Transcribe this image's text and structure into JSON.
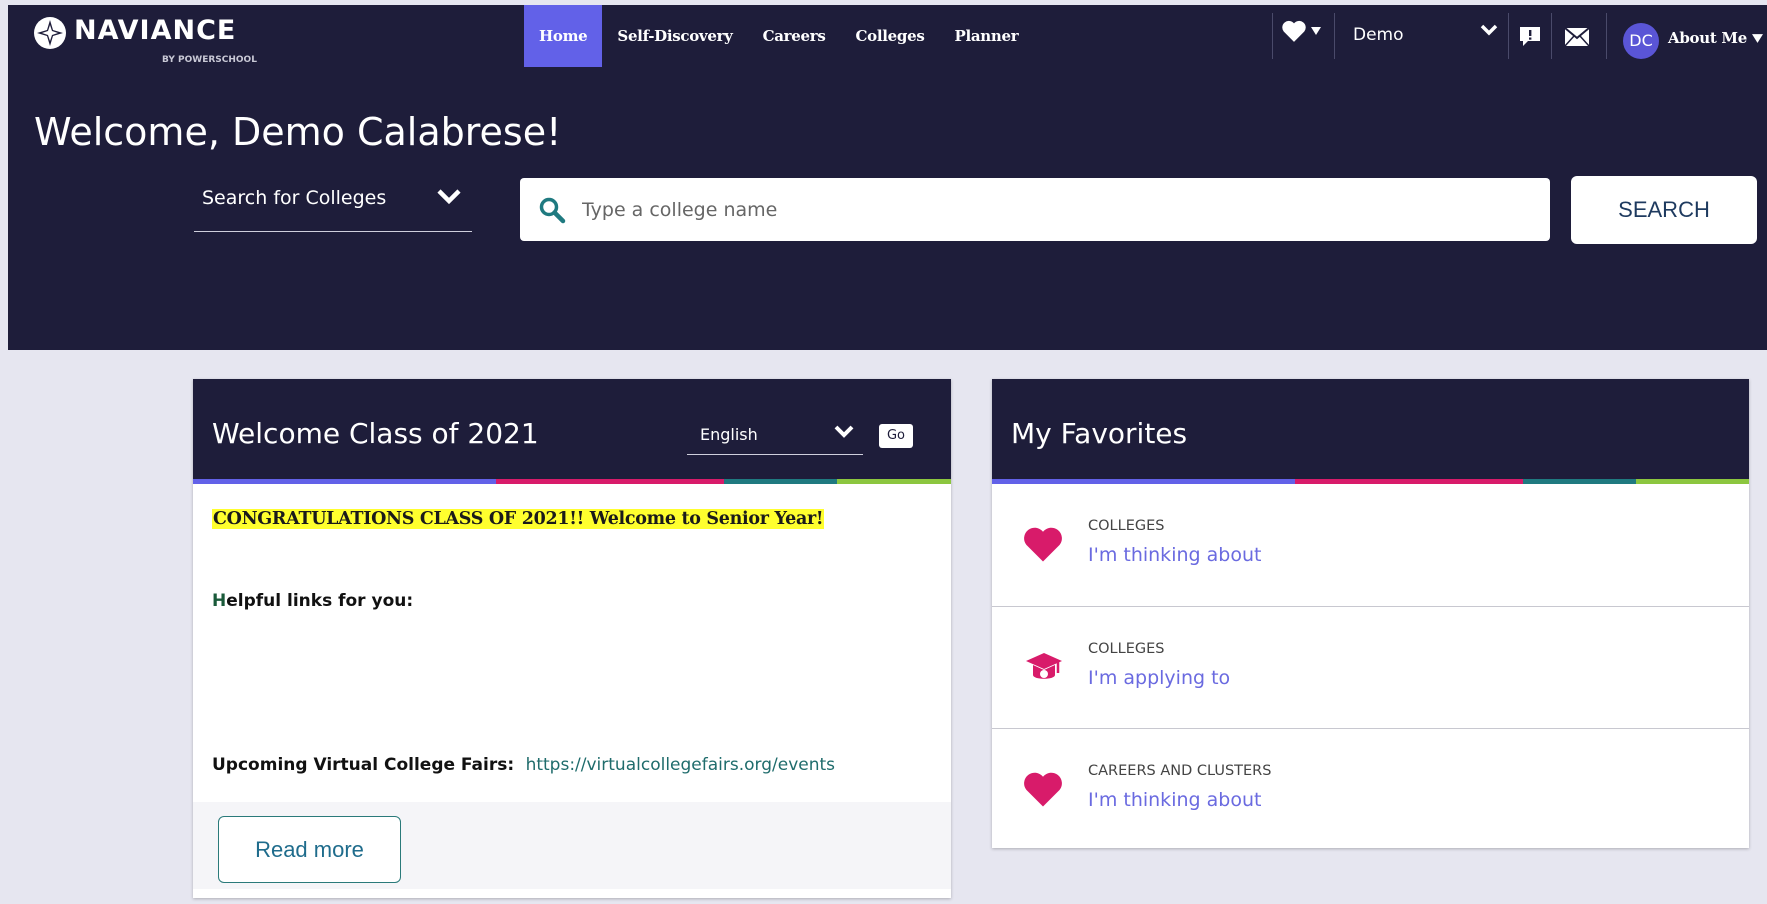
{
  "brand": {
    "name": "NAVIANCE",
    "by": "BY POWERSCHOOL"
  },
  "nav": {
    "items": [
      {
        "label": "Home",
        "active": true
      },
      {
        "label": "Self-Discovery"
      },
      {
        "label": "Careers"
      },
      {
        "label": "Colleges"
      },
      {
        "label": "Planner"
      }
    ]
  },
  "utility": {
    "favorites_icon": "heart-icon",
    "account_select": "Demo",
    "feedback_icon": "chat-exclaim-icon",
    "mail_icon": "envelope-icon",
    "avatar_initials": "DC",
    "about_me": "About Me"
  },
  "hero": {
    "welcome": "Welcome, Demo Calabrese!",
    "search_type": "Search for Colleges",
    "search_placeholder": "Type a college name",
    "search_button": "SEARCH"
  },
  "welcome_card": {
    "title": "Welcome Class of 2021",
    "language": "English",
    "go": "Go",
    "congrats": "CONGRATULATIONS CLASS OF 2021!!  Welcome to Senior Year!",
    "helpful_first": "H",
    "helpful_rest": "elpful links for you:",
    "fairs_label": "Upcoming Virtual College Fairs:",
    "fairs_link": "https://virtualcollegefairs.org/events",
    "read_more": "Read more"
  },
  "favorites_card": {
    "title": "My Favorites",
    "items": [
      {
        "category": "COLLEGES",
        "label": "I'm thinking about",
        "icon": "heart-icon"
      },
      {
        "category": "COLLEGES",
        "label": "I'm applying to",
        "icon": "graduation-cap-icon"
      },
      {
        "category": "CAREERS AND CLUSTERS",
        "label": "I'm thinking about",
        "icon": "heart-icon"
      }
    ]
  },
  "colors": {
    "dark_navy": "#1e1d3a",
    "active_nav": "#6261e8",
    "stripe_purple": "#6261e8",
    "stripe_pink": "#d81b6a",
    "stripe_teal": "#1f7a80",
    "stripe_green": "#8cc63f",
    "favorite_pink": "#d81b6a",
    "link_purple": "#6a6ae0"
  }
}
